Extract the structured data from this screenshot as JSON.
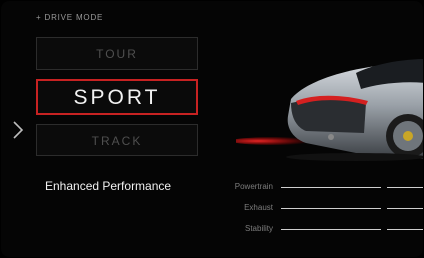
{
  "header": {
    "title": "+ DRIVE  MODE"
  },
  "modes": [
    {
      "label": "TOUR",
      "selected": false
    },
    {
      "label": "SPORT",
      "selected": true
    },
    {
      "label": "TRACK",
      "selected": false
    }
  ],
  "nav": {
    "prev_icon": "chevron-left-icon"
  },
  "description": "Enhanced Performance",
  "metrics": [
    {
      "label": "Powertrain"
    },
    {
      "label": "Exhaust"
    },
    {
      "label": "Stability"
    }
  ],
  "colors": {
    "accent": "#c72222",
    "background": "#000000"
  }
}
